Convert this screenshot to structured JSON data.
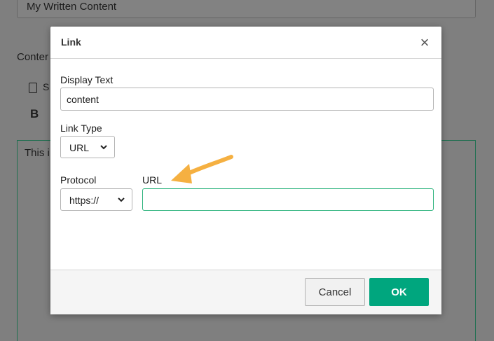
{
  "background": {
    "title_value": "My Written Content",
    "content_label": "Conter",
    "source_label": "S",
    "bold_label": "B",
    "editor_text": "This i"
  },
  "dialog": {
    "title": "Link",
    "close_icon": "×",
    "display_text": {
      "label": "Display Text",
      "value": "content"
    },
    "link_type": {
      "label": "Link Type",
      "value": "URL"
    },
    "protocol": {
      "label": "Protocol",
      "value": "https://"
    },
    "url": {
      "label": "URL",
      "value": ""
    },
    "buttons": {
      "cancel": "Cancel",
      "ok": "OK"
    }
  },
  "colors": {
    "ok_button": "#00a67e",
    "focus_border": "#2ab27b",
    "annotation_arrow": "#f5b041"
  }
}
